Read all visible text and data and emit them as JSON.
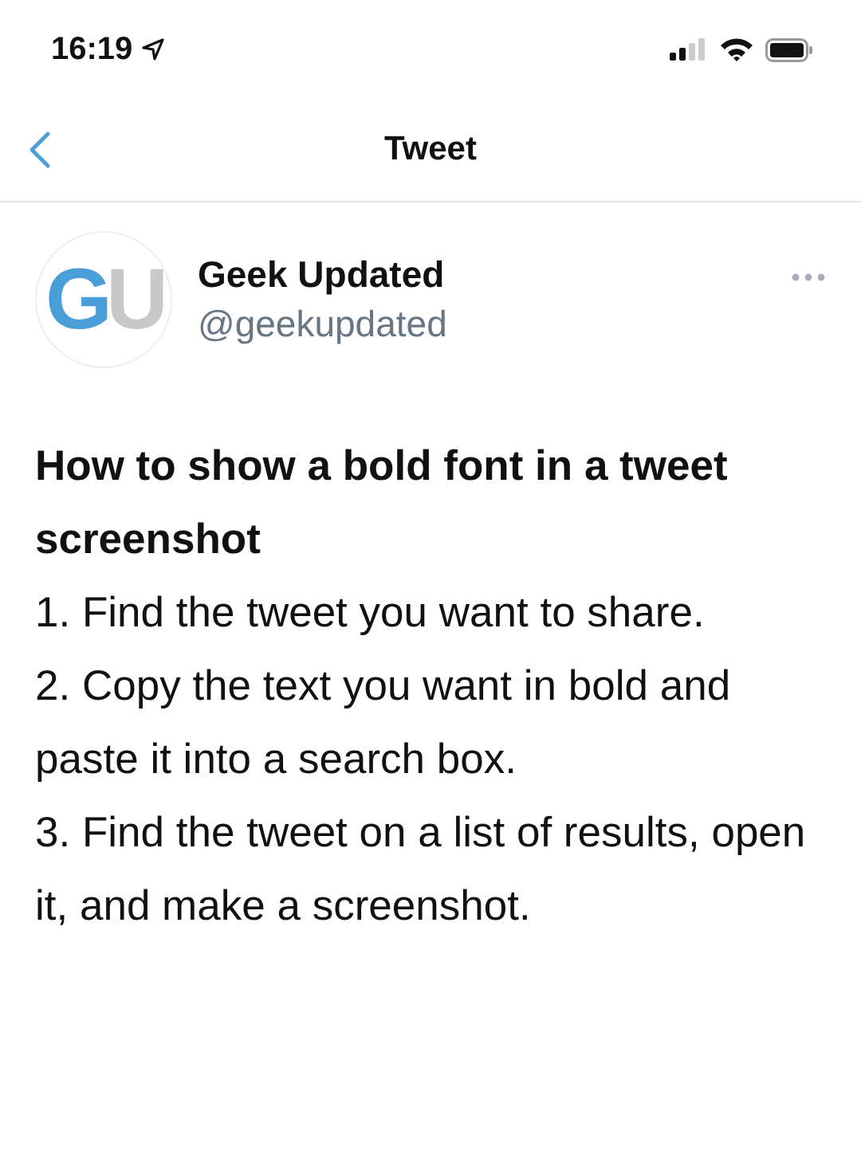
{
  "status_bar": {
    "time": "16:19"
  },
  "nav": {
    "title": "Tweet"
  },
  "tweet": {
    "avatar": {
      "letters": [
        {
          "text": "G",
          "color": "#4a9fd8"
        },
        {
          "text": "U",
          "color": "#c8c8c8"
        }
      ]
    },
    "name": "Geek Updated",
    "handle": "@geekupdated",
    "title": "How to show a bold font in a tweet screenshot",
    "steps": [
      "1. Find the tweet you want to share.",
      "2. Copy the text you want in bold and paste it into a search box.",
      "3. Find the tweet on a list of results, open it, and make a screenshot."
    ]
  }
}
